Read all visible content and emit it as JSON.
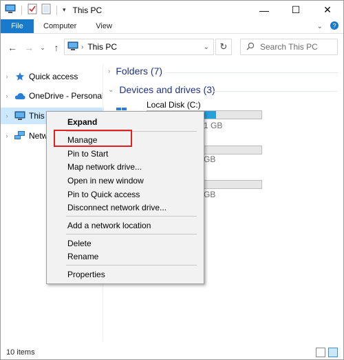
{
  "window": {
    "title": "This PC",
    "controls": {
      "minimize": "—",
      "maximize": "☐",
      "close": "✕"
    }
  },
  "ribbon": {
    "tabs": [
      "File",
      "Computer",
      "View"
    ],
    "expand_icon": "chevron-down-icon",
    "help_icon": "help-icon"
  },
  "address_bar": {
    "path": "This PC",
    "search_placeholder": "Search This PC"
  },
  "nav_pane": {
    "items": [
      {
        "label": "Quick access",
        "icon": "star-icon"
      },
      {
        "label": "OneDrive - Personal",
        "icon": "cloud-icon"
      },
      {
        "label": "This PC",
        "icon": "computer-icon",
        "selected": true
      },
      {
        "label": "Network",
        "icon": "network-icon"
      }
    ],
    "this_pc_visible": "This P",
    "network_visible": "Netwo"
  },
  "content": {
    "folders_header": "Folders (7)",
    "devices_header": "Devices and drives (3)",
    "drives": [
      {
        "name": "Local Disk (C:)",
        "size_text_visible": "1 GB",
        "usage_fraction": 0.6
      },
      {
        "name": "",
        "size_text_visible": "GB",
        "usage_fraction": 0.0
      },
      {
        "name": "",
        "size_text_visible": "GB",
        "usage_fraction": 0.0
      }
    ]
  },
  "context_menu": {
    "items": [
      {
        "label": "Expand",
        "bold": true
      },
      {
        "label": "Manage",
        "highlighted": true
      },
      {
        "label": "Pin to Start"
      },
      {
        "label": "Map network drive..."
      },
      {
        "label": "Open in new window"
      },
      {
        "label": "Pin to Quick access"
      },
      {
        "label": "Disconnect network drive..."
      },
      {
        "label": "Add a network location"
      },
      {
        "label": "Delete"
      },
      {
        "label": "Rename"
      },
      {
        "label": "Properties"
      }
    ]
  },
  "status_bar": {
    "item_count": "10 items"
  },
  "colors": {
    "accent": "#1979ca",
    "selection": "#cce8ff",
    "drive_fill": "#26a0da",
    "highlight_box": "#e02020",
    "group_header": "#1e3287"
  }
}
